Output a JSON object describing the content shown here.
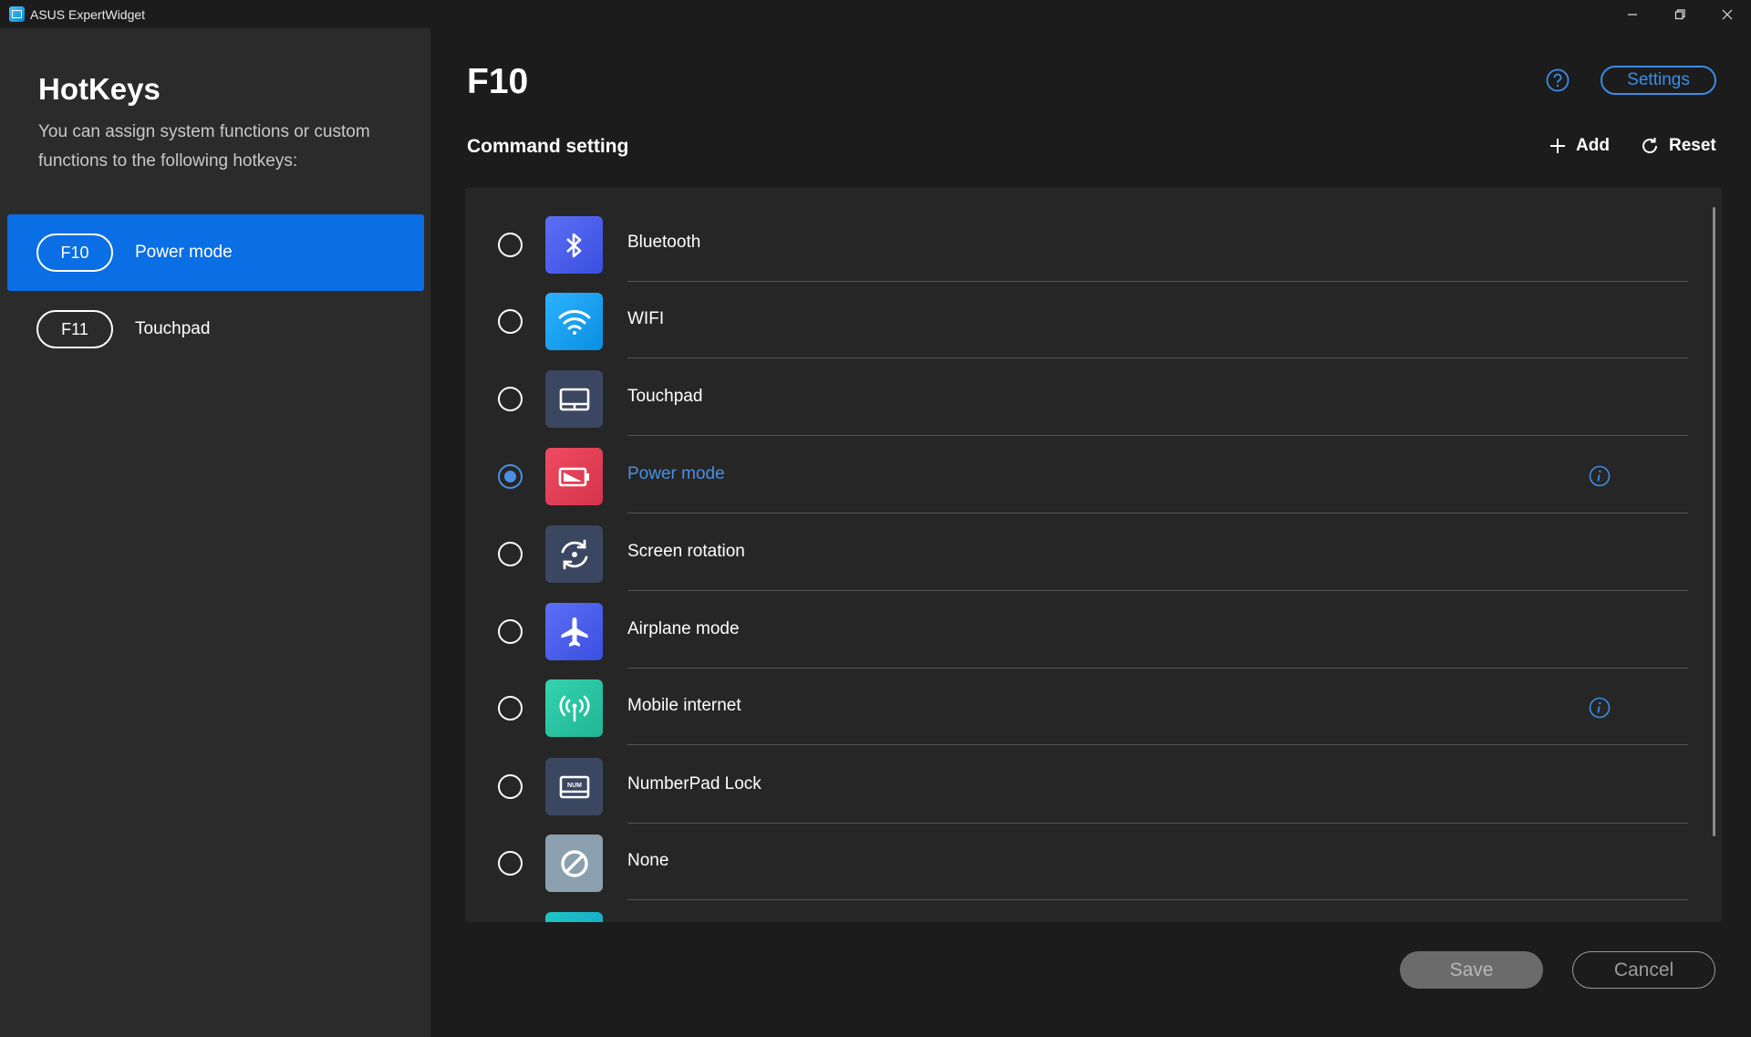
{
  "window": {
    "title": "ASUS ExpertWidget"
  },
  "sidebar": {
    "title": "HotKeys",
    "description": "You can assign system functions or custom functions to the following hotkeys:",
    "hotkeys": [
      {
        "key": "F10",
        "label": "Power mode",
        "active": true
      },
      {
        "key": "F11",
        "label": "Touchpad",
        "active": false
      }
    ]
  },
  "main": {
    "title": "F10",
    "settings_label": "Settings",
    "command_title": "Command setting",
    "add_label": "Add",
    "reset_label": "Reset",
    "commands": [
      {
        "label": "Bluetooth",
        "icon": "bluetooth-icon",
        "color": "#4a5ef0",
        "checked": false
      },
      {
        "label": "WIFI",
        "icon": "wifi-icon",
        "color": "#19a0f0",
        "checked": false
      },
      {
        "label": "Touchpad",
        "icon": "touchpad-icon",
        "color": "#3b4660",
        "checked": false
      },
      {
        "label": "Power mode",
        "icon": "battery-icon",
        "color": "#e0415a",
        "checked": true,
        "info": true
      },
      {
        "label": "Screen rotation",
        "icon": "rotation-icon",
        "color": "#3b4660",
        "checked": false
      },
      {
        "label": "Airplane mode",
        "icon": "airplane-icon",
        "color": "#4a5ef0",
        "checked": false
      },
      {
        "label": "Mobile internet",
        "icon": "antenna-icon",
        "color": "#27c5a3",
        "checked": false,
        "info": true
      },
      {
        "label": "NumberPad Lock",
        "icon": "numberpad-icon",
        "color": "#3b4660",
        "checked": false
      },
      {
        "label": "None",
        "icon": "none-icon",
        "color": "#8aa0ae",
        "checked": false
      }
    ],
    "numberpad_badge": "NUM",
    "save_label": "Save",
    "cancel_label": "Cancel"
  }
}
